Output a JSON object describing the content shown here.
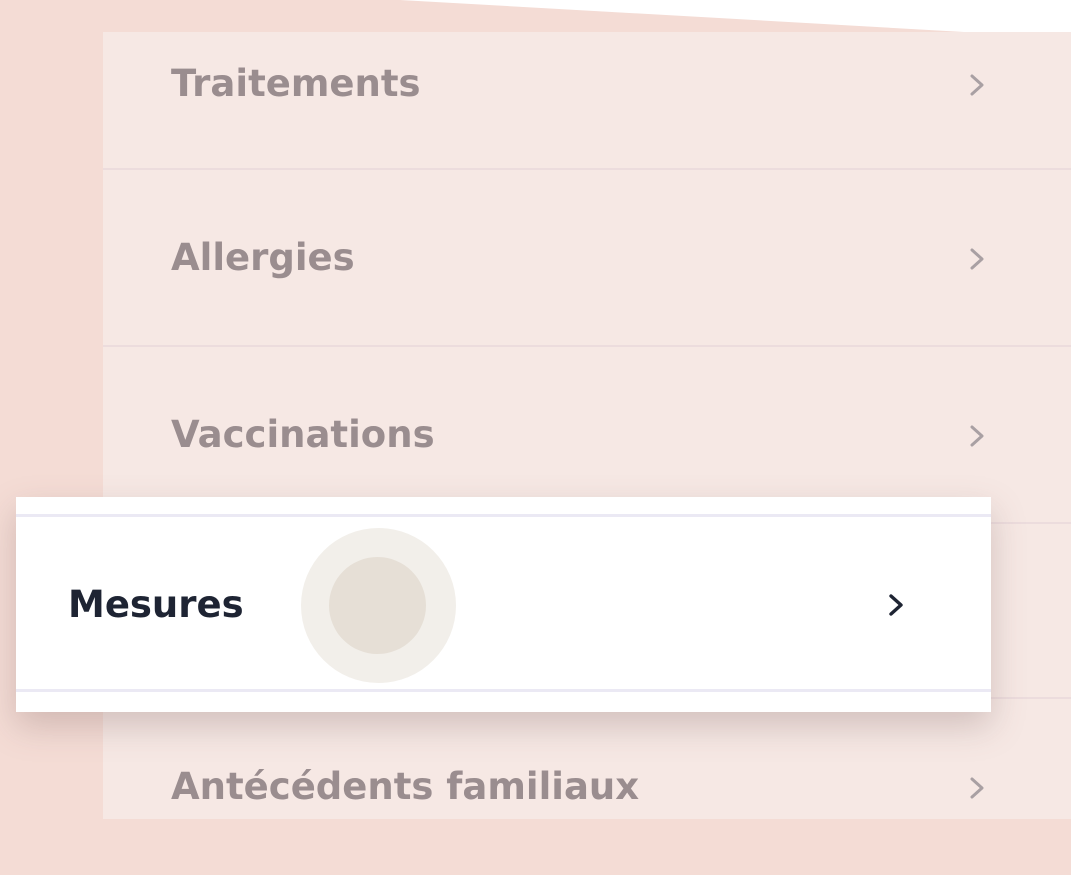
{
  "menu": {
    "items": [
      {
        "label": "Traitements"
      },
      {
        "label": "Allergies"
      },
      {
        "label": "Vaccinations"
      },
      {
        "label": "Mesures"
      },
      {
        "label": "Antécédents familiaux"
      }
    ],
    "active_index": 3
  },
  "icons": {
    "chevron": "chevron-right-icon",
    "touch": "touch-indicator"
  },
  "colors": {
    "background": "#f4dcd5",
    "panel": "#f6e8e4",
    "label_muted": "#9a8d8f",
    "label_active": "#1e2433",
    "active_row": "#ffffff",
    "touch_outer": "#f2efea",
    "touch_inner": "#e6dfd6"
  }
}
